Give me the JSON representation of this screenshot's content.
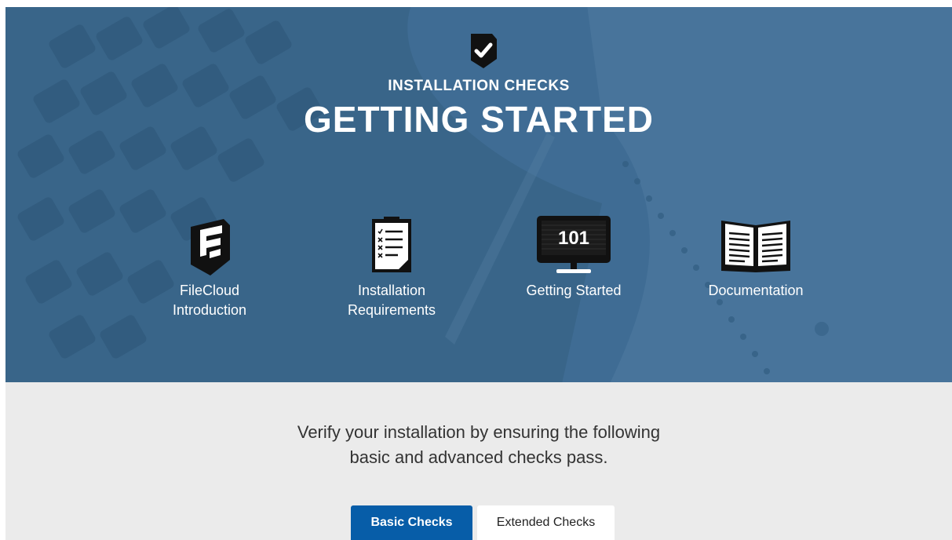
{
  "hero": {
    "badge_icon": "shield-check-icon",
    "eyebrow": "INSTALLATION CHECKS",
    "title": "GETTING STARTED",
    "background_color": "#3f6c94"
  },
  "nav": [
    {
      "label": "FileCloud\nIntroduction",
      "icon": "filecloud-logo-icon"
    },
    {
      "label": "Installation\nRequirements",
      "icon": "checklist-clipboard-icon"
    },
    {
      "label": "Getting Started",
      "icon": "monitor-101-icon"
    },
    {
      "label": "Documentation",
      "icon": "open-book-icon"
    }
  ],
  "intro": {
    "text": "Verify your installation by ensuring the following\nbasic and advanced checks pass."
  },
  "tabs": {
    "basic": "Basic Checks",
    "extended": "Extended Checks",
    "active_color": "#075da8"
  }
}
